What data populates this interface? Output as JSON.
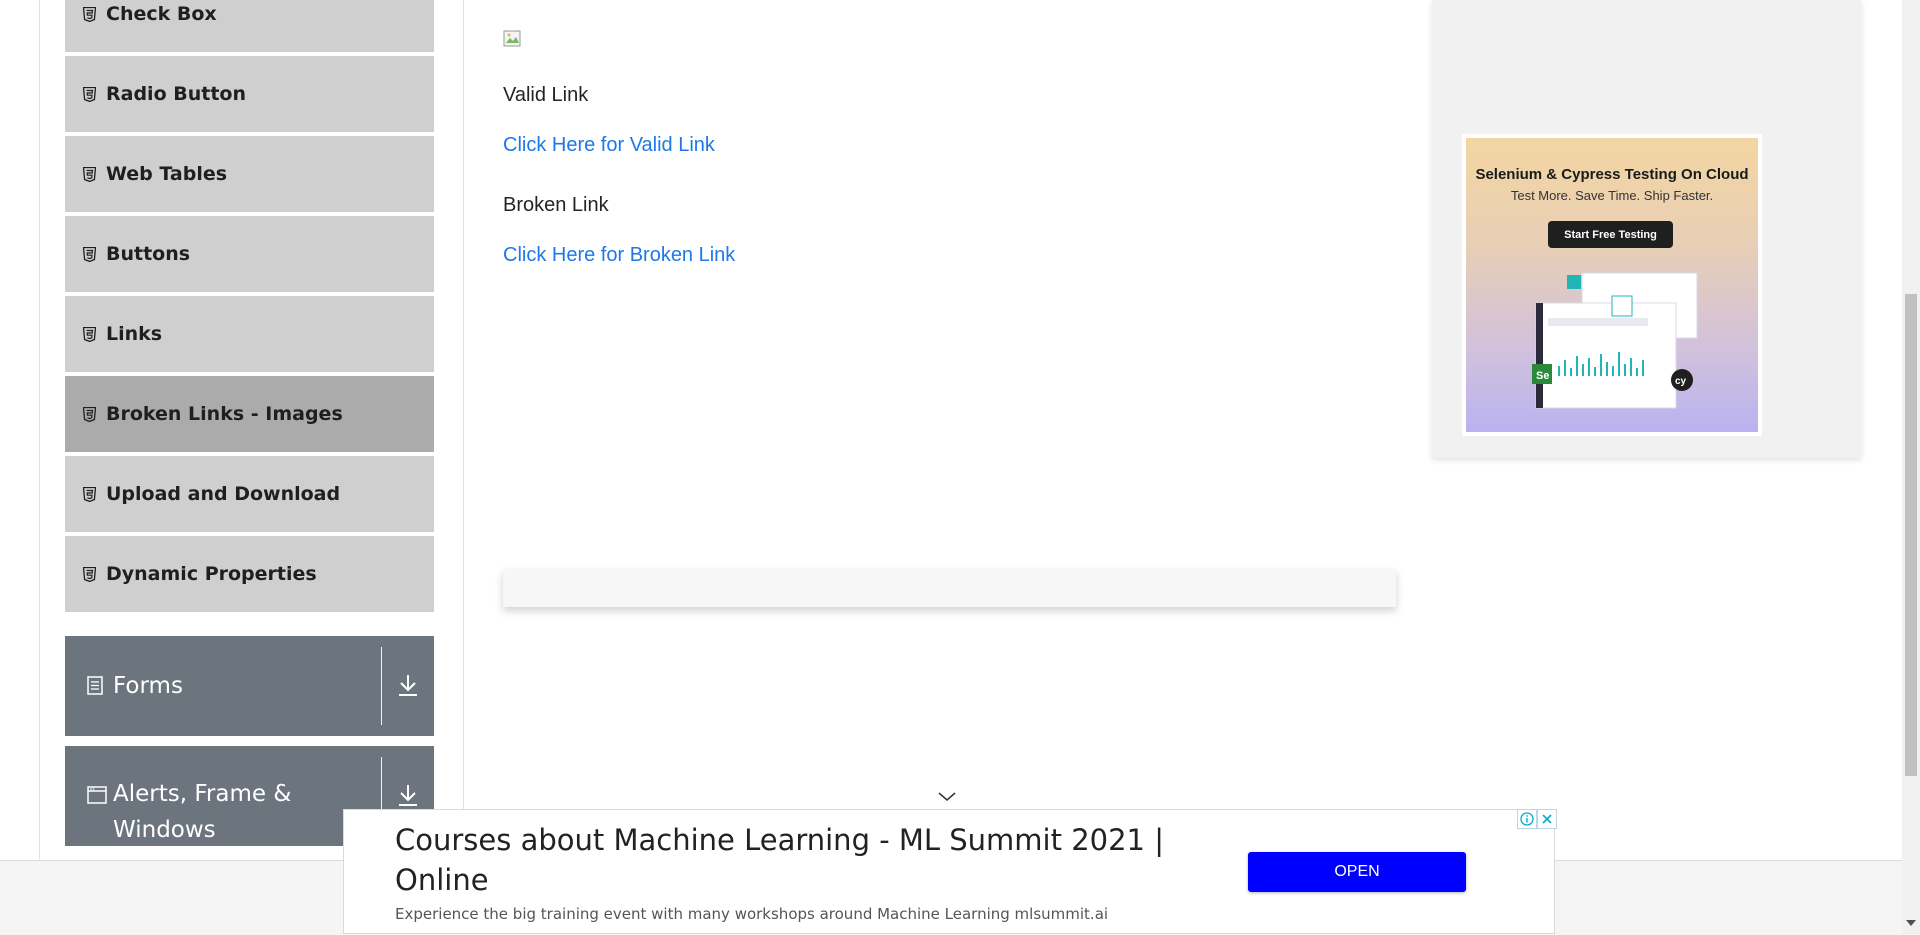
{
  "sidebar": {
    "items": [
      {
        "label": "Check Box",
        "icon": "html5-icon",
        "active": false
      },
      {
        "label": "Radio Button",
        "icon": "html5-icon",
        "active": false
      },
      {
        "label": "Web Tables",
        "icon": "html5-icon",
        "active": false
      },
      {
        "label": "Buttons",
        "icon": "html5-icon",
        "active": false
      },
      {
        "label": "Links",
        "icon": "html5-icon",
        "active": false
      },
      {
        "label": "Broken Links - Images",
        "icon": "html5-icon",
        "active": true
      },
      {
        "label": "Upload and Download",
        "icon": "html5-icon",
        "active": false
      },
      {
        "label": "Dynamic Properties",
        "icon": "html5-icon",
        "active": false
      }
    ],
    "groups": [
      {
        "label": "Forms",
        "icon": "form-icon",
        "toggle_icon": "download-arrow-icon"
      },
      {
        "label": "Alerts, Frame & Windows",
        "label_line1": "Alerts, Frame &",
        "label_line2": "Windows",
        "icon": "window-icon",
        "toggle_icon": "download-arrow-icon"
      }
    ]
  },
  "main": {
    "valid_link_heading": "Valid Link",
    "valid_link_text": "Click Here for Valid Link",
    "broken_link_heading": "Broken Link",
    "broken_link_text": "Click Here for Broken Link",
    "link_color": "#1e78e6"
  },
  "side_ad": {
    "title": "Selenium & Cypress Testing On Cloud",
    "subtitle": "Test More. Save Time. Ship Faster.",
    "button": "Start Free Testing"
  },
  "bottom_ad": {
    "title": "Courses about Machine Learning - ML Summit 2021 | Online",
    "description": "Experience the big training event with many workshops around Machine Learning mlsummit.ai",
    "open_label": "OPEN",
    "accent": "#0000ff"
  },
  "colors": {
    "sidebar_item_bg": "#cfcfcf",
    "sidebar_active_bg": "#ababab",
    "group_header_bg": "#6c757d"
  }
}
